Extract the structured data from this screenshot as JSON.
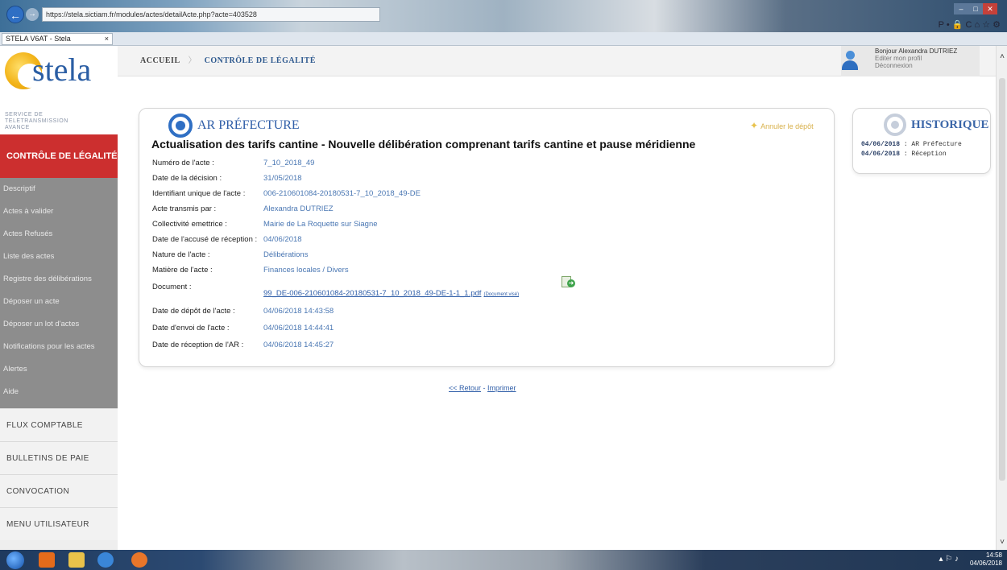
{
  "browser": {
    "url": "https://stela.sictiam.fr/modules/actes/detailActe.php?acte=403528",
    "tab_title": "STELA V6AT - Stela",
    "tools": "P • 🔒 C   ⌂ ☆ ⚙"
  },
  "sidebar": {
    "logo_text": "stela",
    "logo_sub": "SERVICE DE TELETRANSMISSION AVANCE",
    "section_label": "CONTRÔLE DE LÉGALITÉ",
    "items": [
      {
        "label": "Descriptif"
      },
      {
        "label": "Actes à valider"
      },
      {
        "label": "Actes Refusés"
      },
      {
        "label": "Liste des actes"
      },
      {
        "label": "Registre des délibérations"
      },
      {
        "label": "Déposer un acte"
      },
      {
        "label": "Déposer un lot d'actes"
      },
      {
        "label": "Notifications pour les actes"
      },
      {
        "label": "Alertes"
      },
      {
        "label": "Aide"
      }
    ],
    "bottom_items": [
      {
        "label": "FLUX COMPTABLE"
      },
      {
        "label": "BULLETINS DE PAIE"
      },
      {
        "label": "CONVOCATION"
      },
      {
        "label": "MENU UTILISATEUR"
      }
    ]
  },
  "header": {
    "breadcrumb_home": "ACCUEIL",
    "breadcrumb_current": "CONTRÔLE DE LÉGALITÉ",
    "user_greeting": "Bonjour Alexandra DUTRIEZ",
    "edit_profile": "Editer mon profil",
    "logout": "Déconnexion"
  },
  "card": {
    "title": "AR PRÉFECTURE",
    "cancel_label": "Annuler le dépôt",
    "acte_title": "Actualisation des tarifs cantine - Nouvelle délibération comprenant tarifs cantine et pause méridienne",
    "fields": [
      {
        "label": "Numéro de l'acte :",
        "value": "7_10_2018_49"
      },
      {
        "label": "Date de la décision :",
        "value": "31/05/2018"
      },
      {
        "label": "Identifiant unique de l'acte :",
        "value": "006-210601084-20180531-7_10_2018_49-DE"
      },
      {
        "label": "Acte transmis par :",
        "value": "Alexandra DUTRIEZ"
      },
      {
        "label": "Collectivité emettrice :",
        "value": "Mairie de La Roquette sur Siagne"
      },
      {
        "label": "Date de l'accusé de réception :",
        "value": "04/06/2018"
      },
      {
        "label": "Nature de l'acte :",
        "value": "Délibérations"
      },
      {
        "label": "Matière de l'acte :",
        "value": "Finances locales / Divers"
      }
    ],
    "document_label": "Document :",
    "document_file": "99_DE-006-210601084-20180531-7_10_2018_49-DE-1-1_1.pdf",
    "document_small": "(Document visé)",
    "dates": [
      {
        "label": "Date de dépôt de l'acte :",
        "value": "04/06/2018 14:43:58"
      },
      {
        "label": "Date d'envoi de l'acte :",
        "value": "04/06/2018 14:44:41"
      },
      {
        "label": "Date de réception de l'AR :",
        "value": "04/06/2018 14:45:27"
      }
    ]
  },
  "footer": {
    "back": "<< Retour",
    "sep": " - ",
    "print": "Imprimer"
  },
  "history": {
    "title": "HISTORIQUE",
    "entries": [
      {
        "date": "04/06/2018",
        "event": " : AR Préfecture"
      },
      {
        "date": "04/06/2018",
        "event": " : Réception"
      }
    ]
  },
  "taskbar": {
    "time": "14:58",
    "date": "04/06/2018"
  }
}
